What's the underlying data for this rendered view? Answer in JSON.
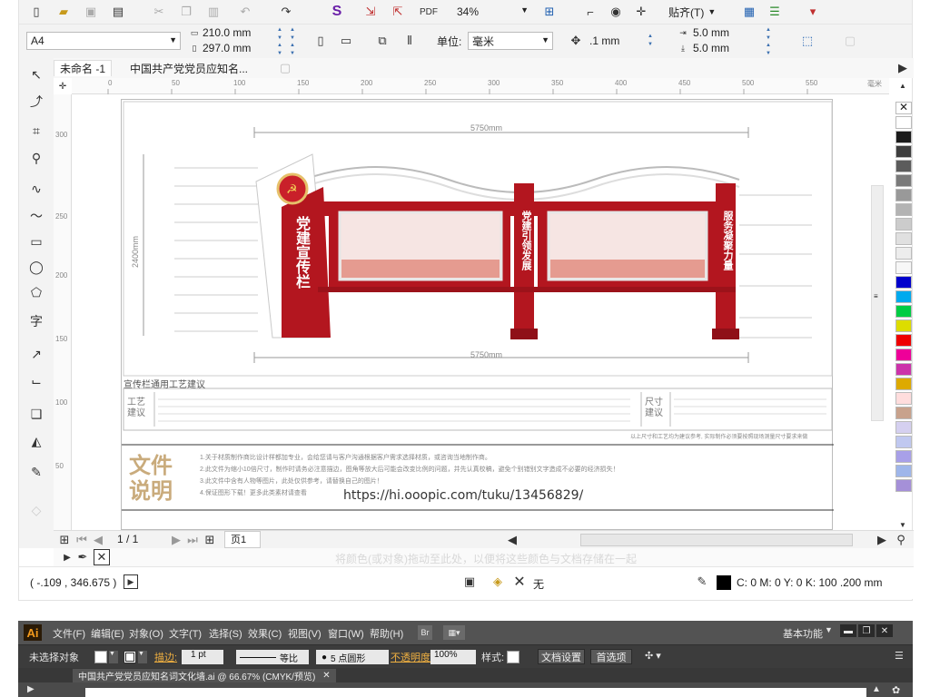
{
  "toolbar_top": {
    "zoom": "34%",
    "snap_label": "贴齐(T)"
  },
  "toolbar_props": {
    "page_size": "A4",
    "width": "210.0 mm",
    "height": "297.0 mm",
    "units_label": "单位:",
    "units_value": "毫米",
    "nudge": ".1 mm",
    "dup_x": "5.0 mm",
    "dup_y": "5.0 mm"
  },
  "doc_tabs": [
    "未命名 -1",
    "中国共产党党员应知名..."
  ],
  "ruler_h": [
    "0",
    "50",
    "100",
    "150",
    "200",
    "250",
    "300",
    "350",
    "400",
    "450",
    "500",
    "550",
    "毫米"
  ],
  "ruler_v": [
    "300",
    "250",
    "200",
    "150",
    "100",
    "50"
  ],
  "artwork": {
    "dim_top": "5750mm",
    "dim_bottom": "5750mm",
    "dim_left": "2400mm",
    "logo_title": "党建宣传栏",
    "post1_text": "党建引领发展",
    "post2_text": "服务凝聚力量",
    "craft_heading": "宣传栏通用工艺建议",
    "craft_label_left": "工艺建议",
    "craft_label_right": "尺寸建议",
    "craft_note": "以上尺寸和工艺均为建议参考, 实际制作必须要按照现场测量尺寸要求来做",
    "notice_title": "文件说明",
    "notice_lines": [
      "1.关于材质制作商比设计样都加专业，会给您请与客户沟通根据客户需求选择材质，或咨询当地制作商。",
      "2.此文件为缩小10倍尺寸，制作时请务必注意描边，图角等放大后可能会改变比例的问题，并先认真校稿，避免个别错别文字造成不必要的经济损失！",
      "3.此文件中含有人物等图片，此处仅供参考，请替换自己的图片！",
      "4.保证图形下载！更多此类素材请查看"
    ],
    "url": "https://hi.ooopic.com/tuku/13456829/"
  },
  "nav": {
    "page_count": "1 / 1",
    "page_tab": "页1"
  },
  "hint_text": "将颜色(或对象)拖动至此处，以便将这些颜色与文档存储在一起",
  "status": {
    "coords": "( -.109 , 346.675 )",
    "fill_label": "无",
    "color_info": "C: 0 M: 0 Y: 0 K: 100  .200 mm"
  },
  "palette_colors": [
    "#ffffff",
    "#1a1a1a",
    "#3d3d3d",
    "#5c5c5c",
    "#7a7a7a",
    "#999999",
    "#b3b3b3",
    "#cccccc",
    "#e0e0e0",
    "#ededed",
    "#f7f7f7",
    "#0000cc",
    "#00aaee",
    "#00cc44",
    "#dddd00",
    "#ee0000",
    "#ee0099",
    "#cc33aa",
    "#ddaa00",
    "#ffdddd",
    "#c8a28c",
    "#d5d0f0",
    "#c0c8f0",
    "#a8a0e8",
    "#9fb6ea",
    "#a590d8"
  ],
  "illustrator": {
    "logo": "Ai",
    "menus": [
      "文件(F)",
      "编辑(E)",
      "对象(O)",
      "文字(T)",
      "选择(S)",
      "效果(C)",
      "视图(V)",
      "窗口(W)",
      "帮助(H)"
    ],
    "workspace": "基本功能",
    "no_selection": "未选择对象",
    "stroke_label": "描边:",
    "stroke_weight": "1 pt",
    "profile": "等比",
    "brush": "5 点圆形",
    "opacity_label": "不透明度:",
    "opacity_value": "100%",
    "style_label": "样式:",
    "doc_setup": "文档设置",
    "prefs": "首选项",
    "doc_tab": "中国共产党党员应知名词文化墙.ai @ 66.67% (CMYK/预览)"
  }
}
